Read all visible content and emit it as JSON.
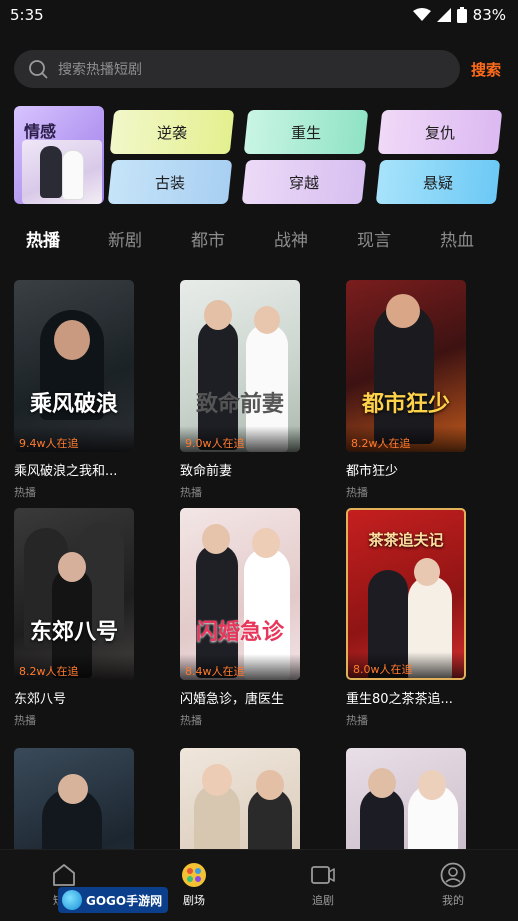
{
  "status": {
    "time": "5:35",
    "battery": "83%"
  },
  "search": {
    "placeholder": "搜索热播短剧",
    "button": "搜索"
  },
  "genres": {
    "featured": "情感",
    "chips": [
      "逆袭",
      "重生",
      "复仇",
      "古装",
      "穿越",
      "悬疑"
    ]
  },
  "tabs": [
    "热播",
    "新剧",
    "都市",
    "战神",
    "现言",
    "热血"
  ],
  "dramas": [
    {
      "title": "乘风破浪之我和...",
      "tag": "热播",
      "views": "9.4w人在追",
      "poster_text": "乘风破浪"
    },
    {
      "title": "致命前妻",
      "tag": "热播",
      "views": "9.0w人在追",
      "poster_text": "致命前妻"
    },
    {
      "title": "都市狂少",
      "tag": "热播",
      "views": "8.2w人在追",
      "poster_text": "都市狂少"
    },
    {
      "title": "东郊八号",
      "tag": "热播",
      "views": "8.2w人在追",
      "poster_text": "东郊八号"
    },
    {
      "title": "闪婚急诊，唐医生",
      "tag": "热播",
      "views": "8.4w人在追",
      "poster_text": "闪婚急诊"
    },
    {
      "title": "重生80之茶茶追...",
      "tag": "热播",
      "views": "8.0w人在追",
      "poster_text": "茶茶追夫记"
    },
    {
      "title": "",
      "tag": "",
      "views": "",
      "poster_text": ""
    },
    {
      "title": "",
      "tag": "",
      "views": "",
      "poster_text": ""
    },
    {
      "title": "",
      "tag": "",
      "views": "",
      "poster_text": ""
    }
  ],
  "nav": [
    {
      "label": "短剧",
      "icon": "home-icon"
    },
    {
      "label": "剧场",
      "icon": "theater-icon"
    },
    {
      "label": "追剧",
      "icon": "video-icon"
    },
    {
      "label": "我的",
      "icon": "profile-icon"
    }
  ],
  "watermark": "GOGO手游网",
  "colors": {
    "accent": "#ff6b1a",
    "background": "#121212"
  }
}
